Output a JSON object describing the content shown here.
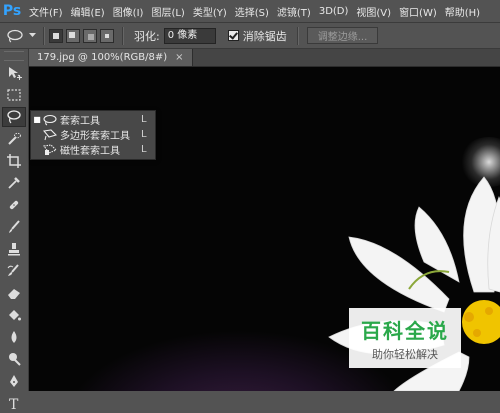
{
  "app": {
    "logo": "Ps",
    "brand_color": "#31a8ff"
  },
  "menubar": {
    "items": [
      "文件(F)",
      "编辑(E)",
      "图像(I)",
      "图层(L)",
      "类型(Y)",
      "选择(S)",
      "滤镜(T)",
      "3D(D)",
      "视图(V)",
      "窗口(W)",
      "帮助(H)"
    ]
  },
  "options": {
    "feather_label": "羽化:",
    "feather_value": "0 像素",
    "antialias_label": "消除锯齿",
    "antialias_checked": true,
    "refine_edge_label": "调整边缘..."
  },
  "document": {
    "tab_title": "179.jpg @ 100%(RGB/8#)",
    "close_glyph": "×"
  },
  "flyout": {
    "items": [
      {
        "label": "套索工具",
        "shortcut": "L",
        "selected": true,
        "icon": "lasso-icon"
      },
      {
        "label": "多边形套索工具",
        "shortcut": "L",
        "selected": false,
        "icon": "polygonal-lasso-icon"
      },
      {
        "label": "磁性套索工具",
        "shortcut": "L",
        "selected": false,
        "icon": "magnetic-lasso-icon"
      }
    ]
  },
  "toolbar": {
    "tools": [
      "move-tool-icon",
      "marquee-tool-icon",
      "lasso-tool-icon",
      "quick-selection-icon",
      "crop-tool-icon",
      "eyedropper-icon",
      "spot-healing-icon",
      "brush-icon",
      "clone-stamp-icon",
      "history-brush-icon",
      "eraser-icon",
      "paint-bucket-icon",
      "blur-icon",
      "dodge-icon",
      "pen-icon",
      "type-icon"
    ]
  },
  "watermark": {
    "title": "百科全说",
    "subtitle": "助你轻松解决"
  }
}
